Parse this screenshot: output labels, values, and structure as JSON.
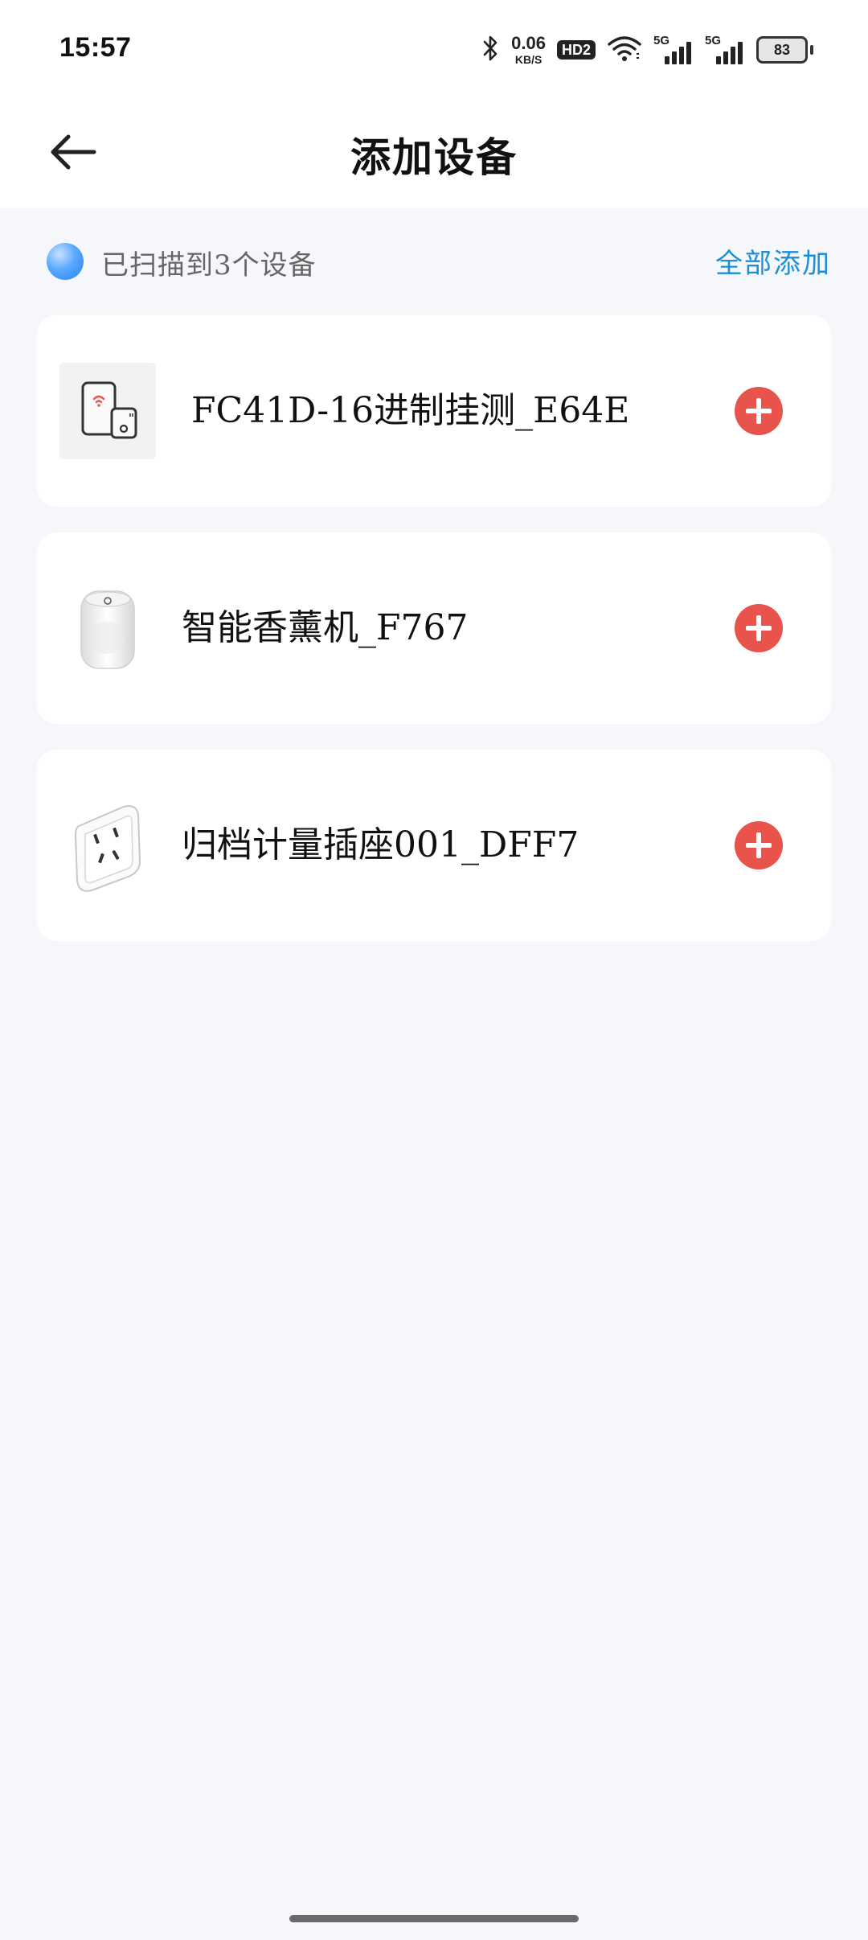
{
  "status_bar": {
    "time": "15:57",
    "net_speed_value": "0.06",
    "net_speed_unit": "KB/S",
    "hd_label": "HD2",
    "signal1_label": "5G",
    "signal2_label": "5G",
    "battery": "83",
    "icons": [
      "bluetooth-icon",
      "wifi-icon",
      "signal-icon",
      "battery-icon"
    ]
  },
  "header": {
    "title": "添加设备",
    "back_icon": "arrow-left-icon"
  },
  "scan": {
    "status_text": "已扫描到3个设备",
    "add_all_label": "全部添加"
  },
  "devices": [
    {
      "name": "FC41D-16进制挂测_E64E",
      "icon": "phone-tablet-wifi-icon"
    },
    {
      "name": "智能香薰机_F767",
      "icon": "aroma-diffuser-icon"
    },
    {
      "name": "归档计量插座001_DFF7",
      "icon": "smart-plug-icon"
    }
  ],
  "colors": {
    "accent": "#1d8fd6",
    "add_button": "#e8534b",
    "background": "#f5f7fb"
  }
}
